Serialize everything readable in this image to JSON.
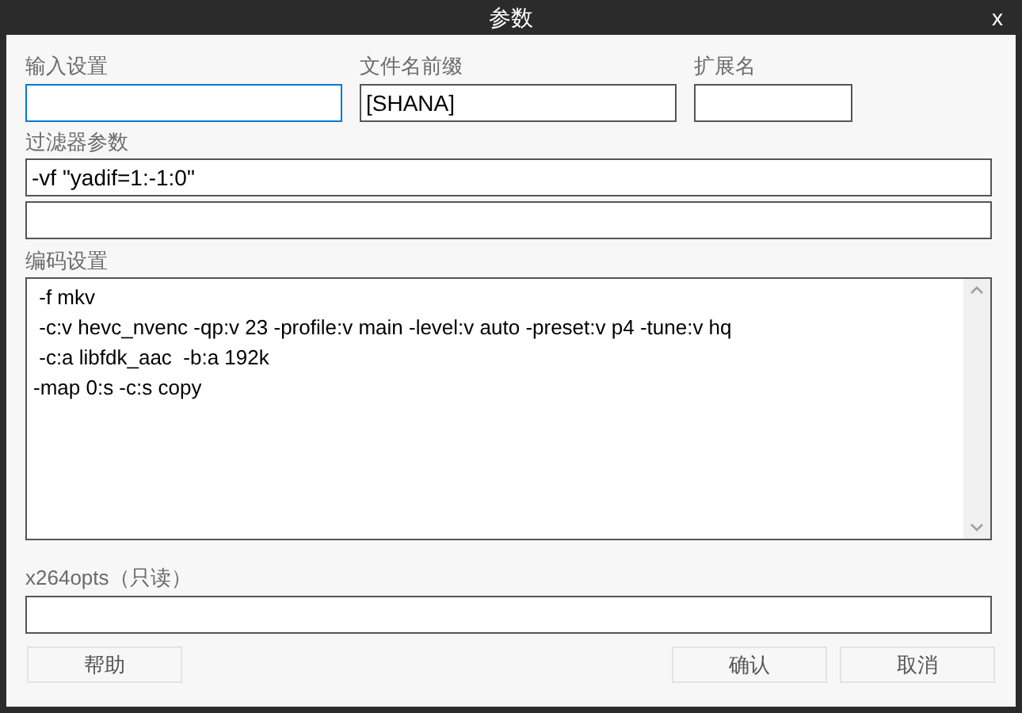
{
  "window": {
    "title": "参数",
    "close": "x"
  },
  "fields": [
    {
      "label": "输入设置",
      "focused": true
    },
    {
      "label": "文件名前缀",
      "value": "[SHANA]",
      "focused": false
    },
    {
      "label": "扩展名",
      "focused": false
    }
  ],
  "filter": {
    "label": "过滤器参数",
    "value": "-vf \"yadif=1:-1:0\"",
    "second_input": true
  },
  "encoding": {
    "label": "编码设置",
    "lines": [
      " -f mkv",
      " -c:v hevc_nvenc -qp:v 23 -profile:v main -level:v auto -preset:v p4 -tune:v hq",
      " -c:a libfdk_aac  -b:a 192k",
      "-map 0:s -c:s copy"
    ]
  },
  "x264opts": {
    "label": "x264opts（只读）"
  },
  "buttons": {
    "help": "帮助",
    "ok": "确认",
    "cancel": "取消"
  }
}
